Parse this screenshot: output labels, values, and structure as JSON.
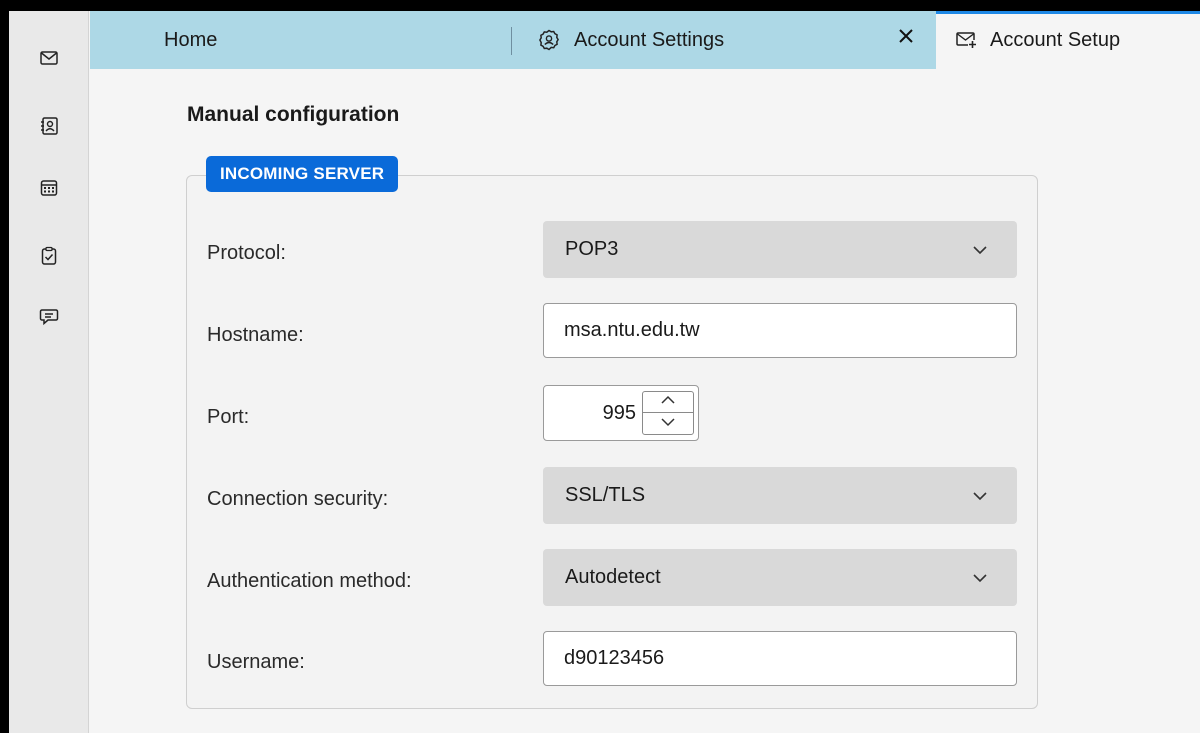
{
  "spaces": [
    {
      "name": "mail",
      "icon": "mail-icon"
    },
    {
      "name": "address-book",
      "icon": "address-book-icon"
    },
    {
      "name": "calendar",
      "icon": "calendar-icon"
    },
    {
      "name": "tasks",
      "icon": "tasks-icon"
    },
    {
      "name": "chat",
      "icon": "chat-icon"
    }
  ],
  "tabs": {
    "home": "Home",
    "account_settings": "Account Settings",
    "account_setup": "Account Setup",
    "active": "account_setup"
  },
  "main": {
    "heading": "Manual configuration",
    "incoming": {
      "legend": "INCOMING SERVER",
      "protocol_label": "Protocol:",
      "protocol_value": "POP3",
      "hostname_label": "Hostname:",
      "hostname_value": "msa.ntu.edu.tw",
      "port_label": "Port:",
      "port_value": "995",
      "security_label": "Connection security:",
      "security_value": "SSL/TLS",
      "auth_label": "Authentication method:",
      "auth_value": "Autodetect",
      "username_label": "Username:",
      "username_value": "d90123456"
    }
  },
  "colors": {
    "tab_strip": "#add8e6",
    "accent": "#0a6ad9",
    "active_tab_indicator": "#1e88e5"
  }
}
